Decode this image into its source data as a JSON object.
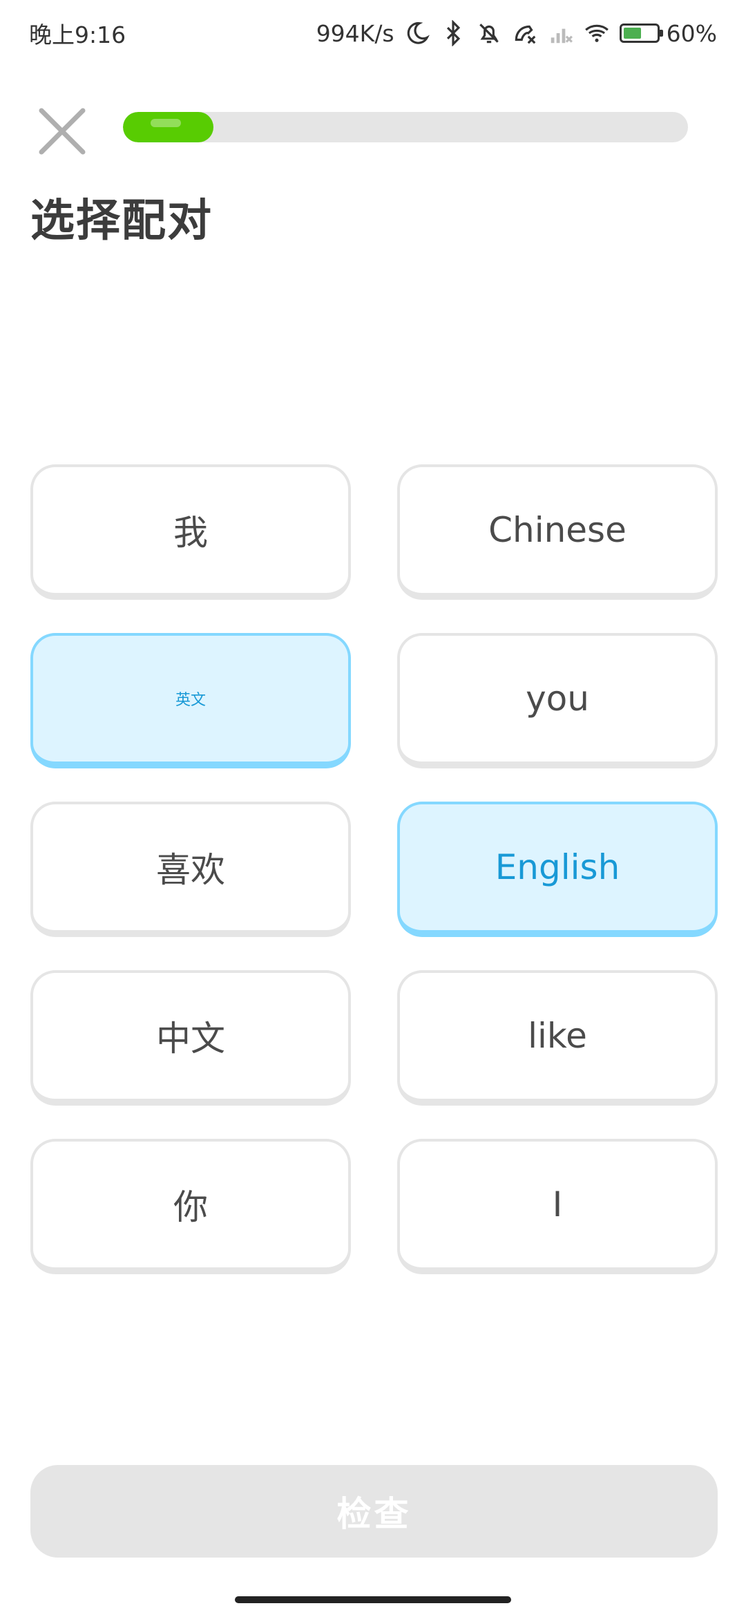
{
  "status_bar": {
    "time": "晚上9:16",
    "network_speed": "994K/s",
    "battery_percent": "60%",
    "battery_level": 0.6,
    "icons": [
      "moon-icon",
      "bluetooth-icon",
      "bell-off-icon",
      "phone-missed-icon",
      "signal-off-icon",
      "wifi-icon",
      "battery-charging-icon"
    ]
  },
  "header": {
    "close_icon": "close-icon",
    "progress": 0.16
  },
  "title": "选择配对",
  "pairs": [
    {
      "left": "我",
      "right": "Chinese"
    },
    {
      "left": "英文",
      "right": "you"
    },
    {
      "left": "喜欢",
      "right": "English"
    },
    {
      "left": "中文",
      "right": "like"
    },
    {
      "left": "你",
      "right": "I"
    }
  ],
  "selected": [
    "英文",
    "English"
  ],
  "check_button": {
    "label": "检查"
  },
  "colors": {
    "accent_green": "#58CC02",
    "selected_bg": "#DDF4FF",
    "selected_border": "#84D8FF",
    "selected_text": "#1899D6",
    "disabled_button": "#E5E5E5"
  }
}
